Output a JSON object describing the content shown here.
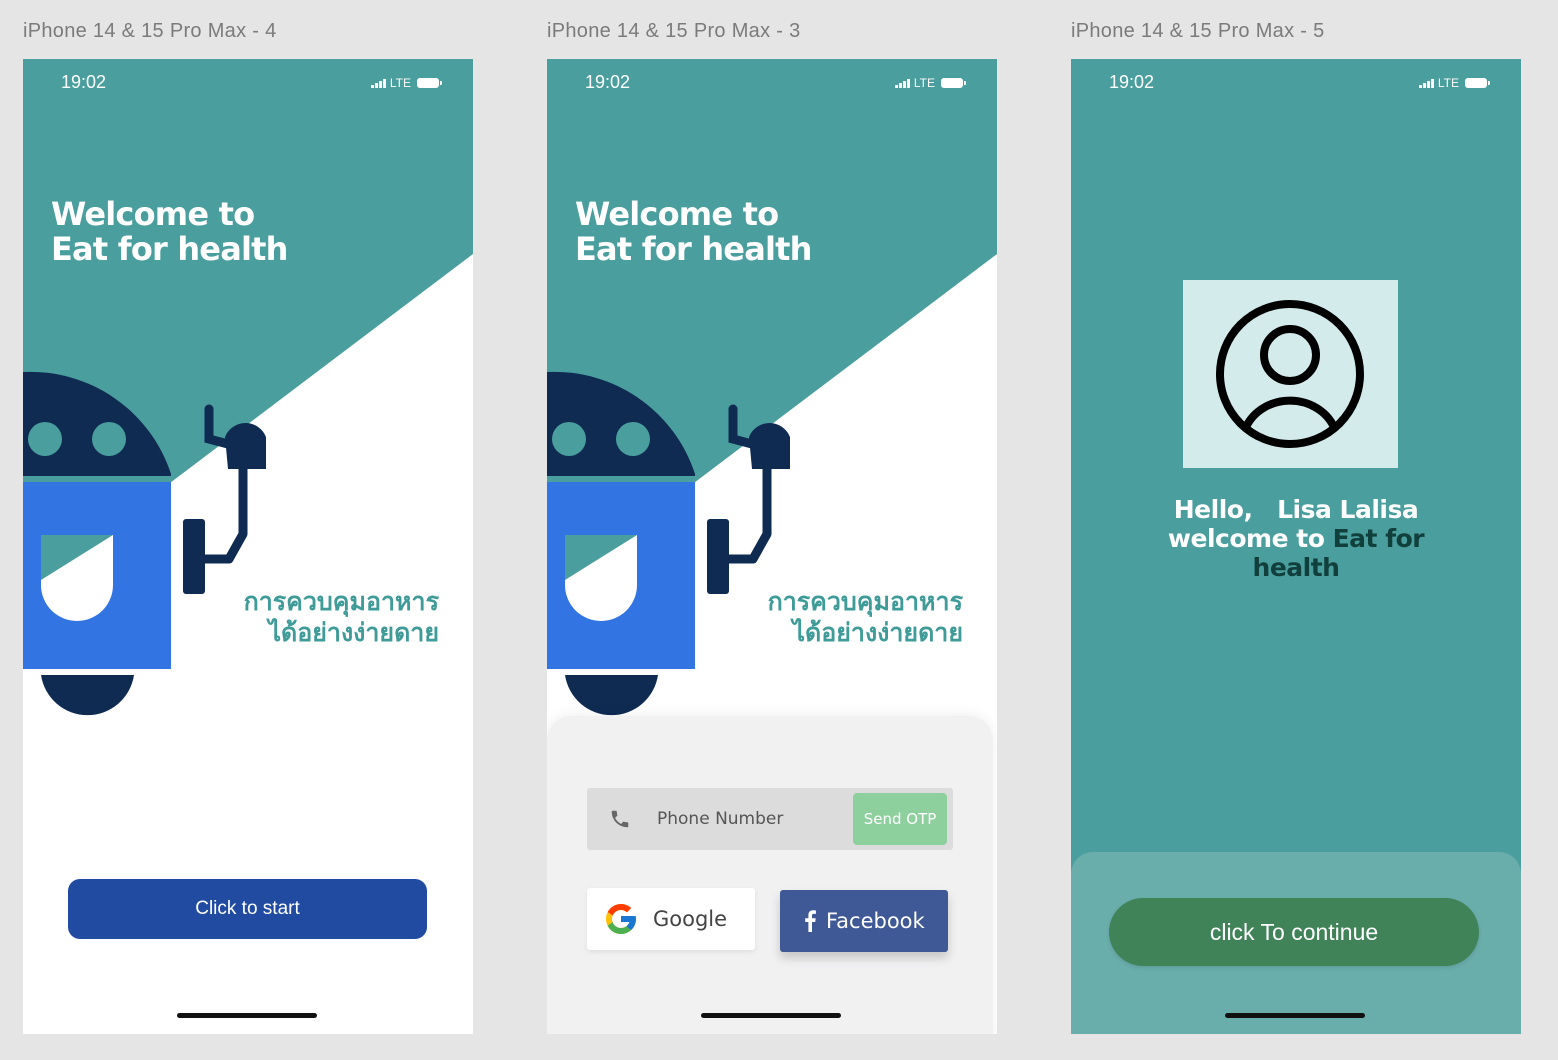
{
  "frames": [
    {
      "label": "iPhone 14 & 15 Pro Max - 4"
    },
    {
      "label": "iPhone 14 & 15 Pro Max - 3"
    },
    {
      "label": "iPhone 14 & 15 Pro Max - 5"
    }
  ],
  "status_bar": {
    "time": "19:02",
    "network": "LTE"
  },
  "welcome": {
    "line1": "Welcome to",
    "line2": "Eat for health",
    "thai_line1": "การควบคุมอาหาร",
    "thai_line2": "ได้อย่างง่ายดาย"
  },
  "screen_start": {
    "button_label": "Click to start"
  },
  "screen_login": {
    "phone_placeholder": "Phone Number",
    "otp_label": "Send OTP",
    "google_label": "Google",
    "facebook_label": "Facebook"
  },
  "screen_hello": {
    "greeting": "Hello,",
    "user_name": "Lisa Lalisa",
    "welcome_prefix": "welcome to",
    "app_name_part1": "Eat for",
    "app_name_part2": "health",
    "button_label": "click To continue"
  },
  "colors": {
    "teal": "#4a9e9e",
    "navy": "#0f2b52",
    "robot_blue": "#3374e3",
    "start_button": "#214ba0",
    "otp_green": "#8dd09d",
    "facebook_blue": "#3f5896",
    "continue_green": "#408359"
  },
  "icons": [
    "phone-icon",
    "google-icon",
    "facebook-icon",
    "user-avatar-icon",
    "robot-illustration"
  ]
}
